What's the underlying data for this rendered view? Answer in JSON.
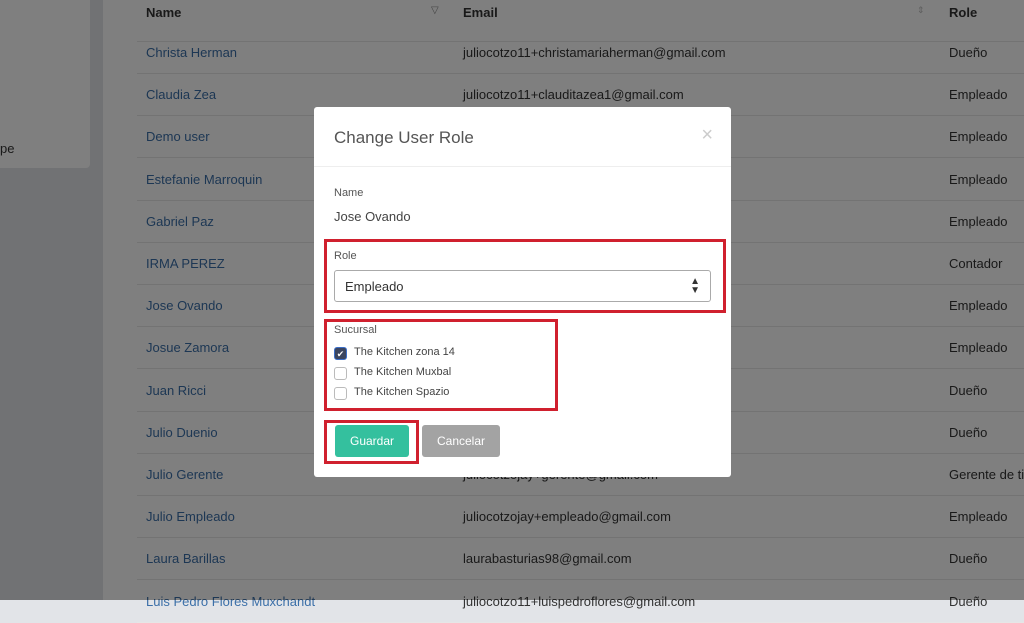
{
  "sidebar": {
    "partial_text": "pe"
  },
  "table": {
    "headers": {
      "name": "Name",
      "email": "Email",
      "role": "Role"
    },
    "rows": [
      {
        "name": "Christa Herman",
        "email": "juliocotzo11+christamariaherman@gmail.com",
        "role": "Dueño"
      },
      {
        "name": "Claudia Zea",
        "email": "juliocotzo11+clauditazea1@gmail.com",
        "role": "Empleado"
      },
      {
        "name": "Demo user",
        "email": "",
        "role": "Empleado"
      },
      {
        "name": "Estefanie Marroquin",
        "email": "",
        "role": "Empleado"
      },
      {
        "name": "Gabriel Paz",
        "email": "",
        "role": "Empleado"
      },
      {
        "name": "IRMA PEREZ",
        "email": "",
        "role": "Contador"
      },
      {
        "name": "Jose Ovando",
        "email": "",
        "role": "Empleado"
      },
      {
        "name": "Josue Zamora",
        "email": "",
        "role": "Empleado"
      },
      {
        "name": "Juan Ricci",
        "email": "",
        "role": "Dueño"
      },
      {
        "name": "Julio Duenio",
        "email": "",
        "role": "Dueño"
      },
      {
        "name": "Julio Gerente",
        "email": "juliocotzojay+gerente@gmail.com",
        "role": "Gerente de ti"
      },
      {
        "name": "Julio Empleado",
        "email": "juliocotzojay+empleado@gmail.com",
        "role": "Empleado"
      },
      {
        "name": "Laura Barillas",
        "email": "laurabasturias98@gmail.com",
        "role": "Dueño"
      },
      {
        "name": "Luis Pedro Flores Muxchandt",
        "email": "juliocotzo11+luispedroflores@gmail.com",
        "role": "Dueño"
      }
    ]
  },
  "modal": {
    "title": "Change User Role",
    "close": "×",
    "name_label": "Name",
    "name_value": "Jose Ovando",
    "role_label": "Role",
    "role_value": "Empleado",
    "sucursal_label": "Sucursal",
    "sucursales": [
      {
        "label": "The Kitchen zona 14",
        "checked": true
      },
      {
        "label": "The Kitchen Muxbal",
        "checked": false
      },
      {
        "label": "The Kitchen Spazio",
        "checked": false
      }
    ],
    "save": "Guardar",
    "cancel": "Cancelar"
  },
  "colors": {
    "save": "#34c09e",
    "cancel": "#a3a3a3",
    "highlight": "#d0202e",
    "link": "#3b6fa8"
  }
}
